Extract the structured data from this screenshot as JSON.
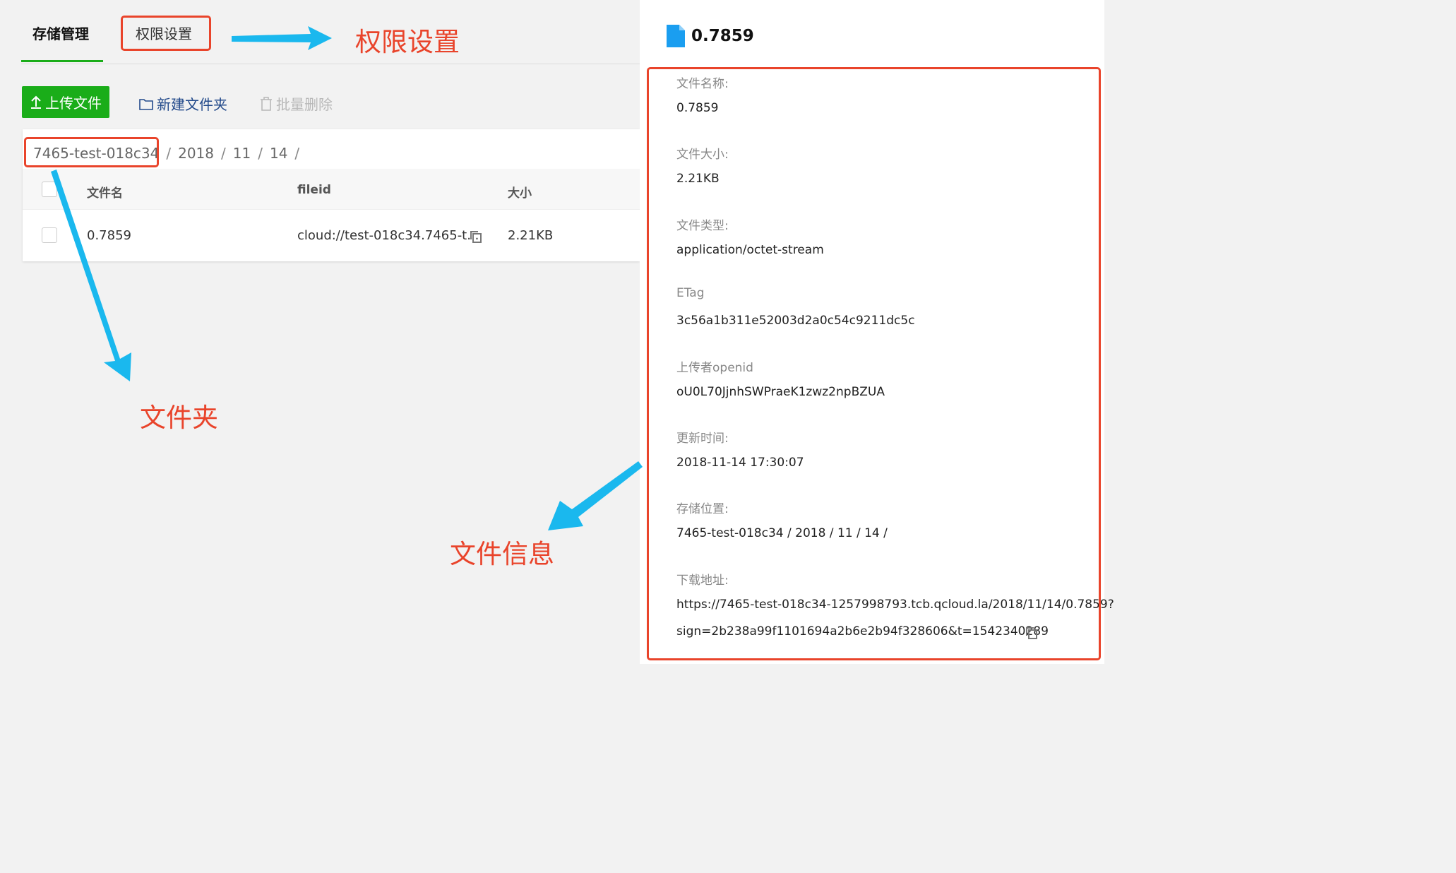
{
  "tabs": {
    "storage": "存储管理",
    "permission": "权限设置"
  },
  "toolbar": {
    "upload": "上传文件",
    "new_folder": "新建文件夹",
    "batch_delete": "批量删除"
  },
  "breadcrumb": [
    "7465-test-018c34",
    "2018",
    "11",
    "14"
  ],
  "table": {
    "columns": [
      "文件名",
      "fileid",
      "大小"
    ],
    "rows": [
      {
        "name": "0.7859",
        "fileid": "cloud://test-018c34.7465-t...",
        "size": "2.21KB"
      }
    ]
  },
  "panel": {
    "title": "0.7859",
    "fields": [
      {
        "label": "文件名称:",
        "value": "0.7859"
      },
      {
        "label": "文件大小:",
        "value": "2.21KB"
      },
      {
        "label": "文件类型:",
        "value": "application/octet-stream"
      },
      {
        "label": "ETag",
        "value": "3c56a1b311e52003d2a0c54c9211dc5c"
      },
      {
        "label": "上传者openid",
        "value": "oU0L70JjnhSWPraeK1zwz2npBZUA"
      },
      {
        "label": "更新时间:",
        "value": "2018-11-14 17:30:07"
      },
      {
        "label": "存储位置:",
        "value": "7465-test-018c34 / 2018 / 11 / 14 /"
      },
      {
        "label": "下载地址:",
        "value": "https://7465-test-018c34-1257998793.tcb.qcloud.la/2018/11/14/0.7859?",
        "value2": "sign=2b238a99f1101694a2b6e2b94f328606&t=1542340289"
      }
    ]
  },
  "annotations": {
    "permission": "权限设置",
    "folder": "文件夹",
    "file_info": "文件信息"
  },
  "colors": {
    "accent_green": "#1aad19",
    "annotation_red": "#e9442b",
    "arrow_blue": "#1ab8ee",
    "file_icon_blue": "#1a9ef0"
  }
}
